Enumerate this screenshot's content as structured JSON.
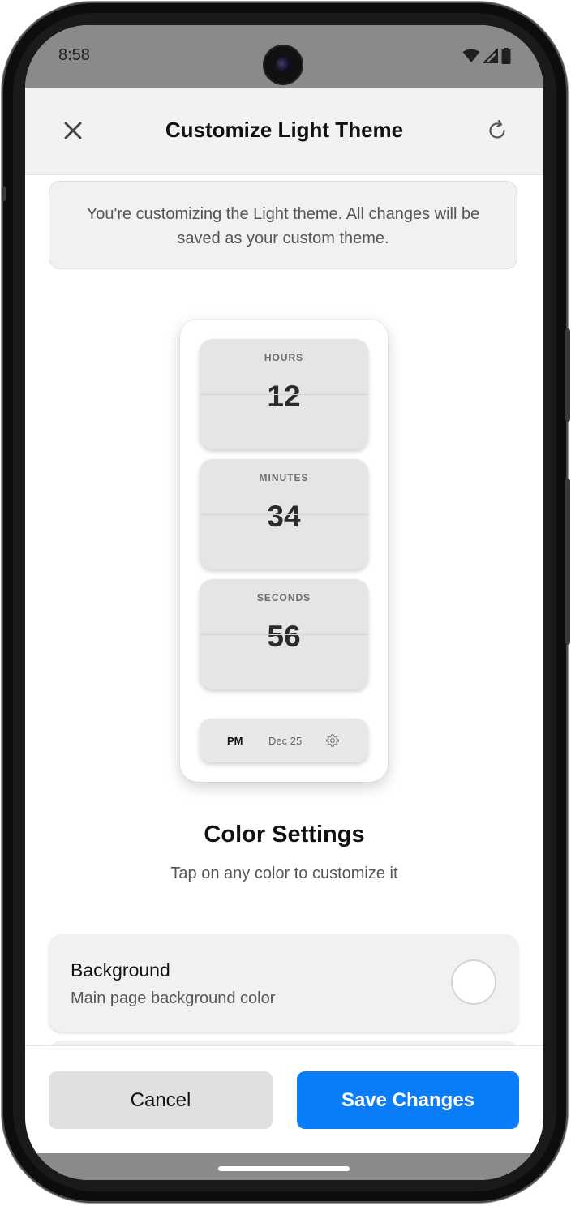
{
  "status_bar": {
    "time": "8:58"
  },
  "header": {
    "title": "Customize Light Theme",
    "close_icon": "close-icon",
    "reset_icon": "refresh-icon"
  },
  "info_message": "You're customizing the Light theme. All changes will be saved as your custom theme.",
  "preview": {
    "cards": [
      {
        "label": "HOURS",
        "value": "12"
      },
      {
        "label": "MINUTES",
        "value": "34"
      },
      {
        "label": "SECONDS",
        "value": "56"
      }
    ],
    "bar": {
      "period": "PM",
      "date": "Dec 25",
      "settings_icon": "gear-icon"
    }
  },
  "color_settings": {
    "title": "Color Settings",
    "subtitle": "Tap on any color to customize it",
    "items": [
      {
        "name": "Background",
        "description": "Main page background color",
        "color": "#ffffff"
      },
      {
        "name": "",
        "description": "",
        "color": "#f1f1f1"
      }
    ]
  },
  "actions": {
    "cancel_label": "Cancel",
    "save_label": "Save Changes"
  },
  "colors": {
    "accent": "#0a7df8",
    "status_bar": "#8a8a8a",
    "card_background": "#e5e5e5"
  }
}
